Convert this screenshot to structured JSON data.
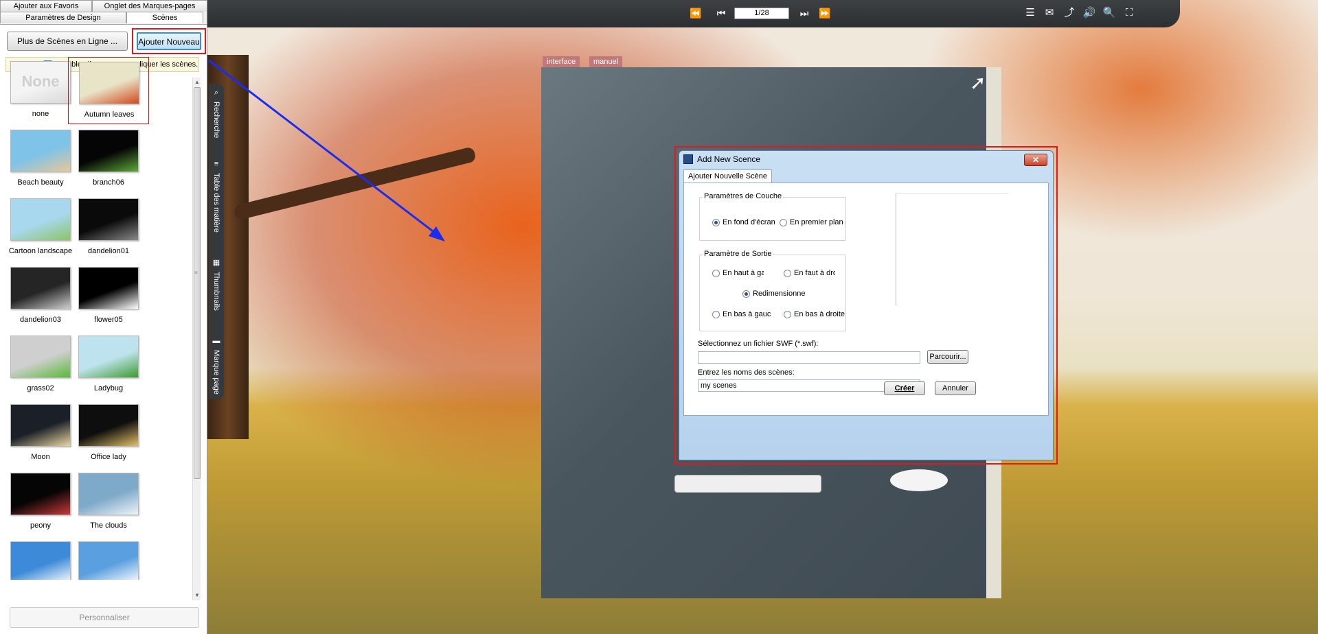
{
  "left_panel": {
    "tabs_top": [
      "Ajouter aux Favoris",
      "Onglet des Marques-pages"
    ],
    "tabs_bottom": [
      "Paramètres de Design",
      "Scènes"
    ],
    "more_scenes_button": "Plus de Scènes en Ligne ...",
    "add_new_button": "Ajouter Nouveau",
    "hint_icon": "i",
    "hint": "Double-cliquez pour appliquer les scènes.",
    "scenes": [
      {
        "label": "none",
        "thumb_text": "None",
        "bg": "#f4f4f4",
        "accent": "#d9d9d9"
      },
      {
        "label": "Autumn leaves",
        "thumb_text": "",
        "bg": "#e8e4c8",
        "accent": "#d2481a"
      },
      {
        "label": "Beach beauty",
        "thumb_text": "",
        "bg": "#7fc3e8",
        "accent": "#e7c89a"
      },
      {
        "label": "branch06",
        "thumb_text": "",
        "bg": "#050505",
        "accent": "#5fa83a"
      },
      {
        "label": "Cartoon landscape",
        "thumb_text": "",
        "bg": "#a8d8ee",
        "accent": "#8cc36a"
      },
      {
        "label": "dandelion01",
        "thumb_text": "",
        "bg": "#0a0a0a",
        "accent": "#8a8a8a"
      },
      {
        "label": "dandelion03",
        "thumb_text": "",
        "bg": "#252525",
        "accent": "#cfcfcf"
      },
      {
        "label": "flower05",
        "thumb_text": "",
        "bg": "#000000",
        "accent": "#ffffff"
      },
      {
        "label": "grass02",
        "thumb_text": "",
        "bg": "#cfcfcf",
        "accent": "#5ab83a"
      },
      {
        "label": "Ladybug",
        "thumb_text": "",
        "bg": "#bfe3ee",
        "accent": "#3e9a2e"
      },
      {
        "label": "Moon",
        "thumb_text": "",
        "bg": "#1a1f28",
        "accent": "#e8d7a0"
      },
      {
        "label": "Office lady",
        "thumb_text": "",
        "bg": "#0e0e0e",
        "accent": "#e3c06a"
      },
      {
        "label": "peony",
        "thumb_text": "",
        "bg": "#050505",
        "accent": "#c83a3a"
      },
      {
        "label": "The clouds",
        "thumb_text": "",
        "bg": "#7ea9c9",
        "accent": "#eef4f8"
      },
      {
        "label": "",
        "thumb_text": "",
        "bg": "#3d8bd8",
        "accent": "#ffffff"
      },
      {
        "label": "",
        "thumb_text": "",
        "bg": "#5a9fe0",
        "accent": "#ffffff"
      }
    ],
    "customize_button": "Personnaliser"
  },
  "viewer": {
    "page_indicator": "1/28",
    "nav_icons": {
      "first": "⏪",
      "prev": "⏮",
      "next": "⏭",
      "last": "⏩"
    },
    "tool_icons": [
      "☰",
      "✉",
      "⤴",
      "🔊",
      "🔍",
      "⛶"
    ],
    "side_tabs": [
      {
        "icon": "⌕",
        "label": "Recherche"
      },
      {
        "icon": "≡",
        "label": "Table des matière"
      },
      {
        "icon": "▦",
        "label": "Thumbnails"
      },
      {
        "icon": "▬",
        "label": "Marque page"
      }
    ],
    "book_tabs": [
      "interface",
      "manuel"
    ],
    "next_page_glyph": "›",
    "cursor_glyph": "➚"
  },
  "dialog": {
    "title": "Add New Scence",
    "close_glyph": "✕",
    "tab": "Ajouter Nouvelle Scène",
    "layer_group": {
      "title": "Paramètres de Couche",
      "options": [
        "En fond d'écran",
        "En premier plan"
      ],
      "selected": 0
    },
    "output_group": {
      "title": "Paramètre de Sortie",
      "options": [
        "En haut à ga",
        "En faut à dro",
        "Redimensionne",
        "En bas à gauch",
        "En bas à droite"
      ],
      "selected": 2
    },
    "swf_label": "Sélectionnez un fichier SWF (*.swf):",
    "swf_value": "",
    "browse_button": "Parcourir...",
    "names_label": "Entrez les noms des scènes:",
    "names_value": "my scenes",
    "create_button": "Créer",
    "cancel_button": "Annuler"
  },
  "colors": {
    "highlight_red": "#e01a1a",
    "arrow_blue": "#1a2cf0",
    "toolbar": "#2f3336"
  }
}
